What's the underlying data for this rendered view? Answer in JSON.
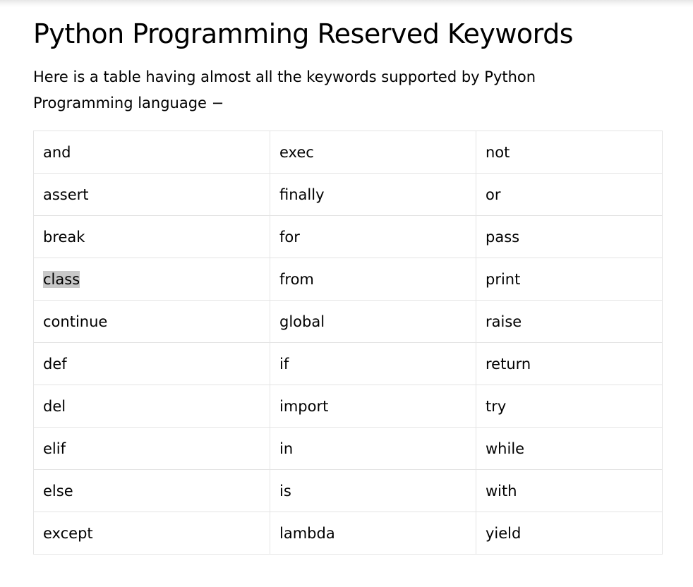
{
  "page": {
    "title": "Python Programming Reserved Keywords",
    "intro": "Here is a table having almost all the keywords supported by Python Programming language −"
  },
  "table": {
    "rows": [
      [
        "and",
        "exec",
        "not"
      ],
      [
        "assert",
        "finally",
        "or"
      ],
      [
        "break",
        "for",
        "pass"
      ],
      [
        "class",
        "from",
        "print"
      ],
      [
        "continue",
        "global",
        "raise"
      ],
      [
        "def",
        "if",
        "return"
      ],
      [
        "del",
        "import",
        "try"
      ],
      [
        "elif",
        "in",
        "while"
      ],
      [
        "else",
        "is",
        "with"
      ],
      [
        "except",
        "lambda",
        "yield"
      ]
    ],
    "selected_text": "class"
  }
}
